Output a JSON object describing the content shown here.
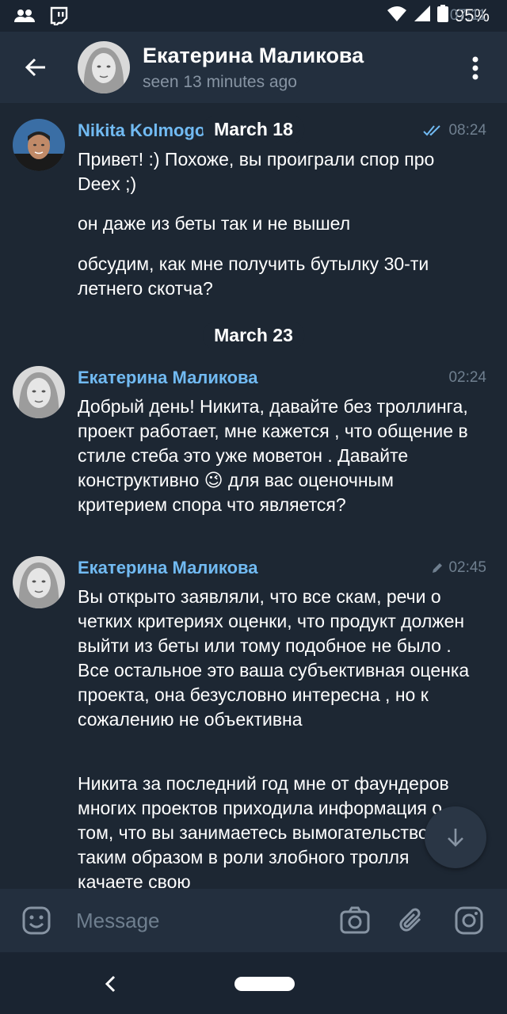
{
  "status_bar": {
    "time": "07:11",
    "battery": "95%",
    "icons": [
      "people-icon",
      "twitch-icon",
      "wifi-icon",
      "signal-icon",
      "battery-icon"
    ]
  },
  "header": {
    "name": "Екатерина Маликова",
    "status": "seen 13 minutes ago",
    "icons": [
      "back-arrow-icon",
      "more-vert-icon"
    ]
  },
  "messages": [
    {
      "sender": "Nikita Kolmogo",
      "time": "08:24",
      "read_receipt": "double-check-icon",
      "paragraphs": [
        "Привет! :) Похоже, вы проиграли спор про Deex ;)",
        "он даже из беты так и не вышел",
        "обсудим, как мне получить бутылку 30-ти летнего скотча?"
      ]
    },
    {
      "sender": "Екатерина Маликова",
      "time": "02:24",
      "paragraphs": [
        "Добрый день! Никита, давайте без троллинга, проект работает, мне кажется , что общение в стиле стеба это уже моветон . Давайте конструктивно 😉 для вас оценочным критерием спора что является?"
      ]
    },
    {
      "sender": "Екатерина Маликова",
      "time": "02:45",
      "edited_icon": "pencil-icon",
      "paragraphs": [
        "Вы открыто заявляли, что все скам, речи о четких критериях оценки, что продукт должен выйти из беты или тому подобное не было . Все остальное это ваша  субъективная оценка проекта, она безусловно интересна , но к сожалению не объективна",
        "Никита за последний год мне от фаундеров многих проектов приходила информация о том, что вы занимаетесь вымогательством и таким образом в роли злобного тролля качаете свою"
      ]
    }
  ],
  "dates": [
    "March 18",
    "March 23"
  ],
  "composer": {
    "placeholder": "Message",
    "icons": [
      "emoji-icon",
      "camera-icon",
      "attach-icon",
      "instagram-icon"
    ]
  },
  "colors": {
    "background": "#1d2733",
    "header": "#232f3e",
    "sender_name": "#71baf2",
    "secondary_text": "#8794a3"
  }
}
